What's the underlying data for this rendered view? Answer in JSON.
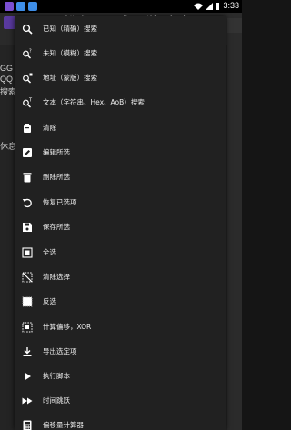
{
  "status_bar": {
    "time": "3:33",
    "app_icon_colors": [
      "#7a4fd0",
      "#3e8ee8",
      "#3e8ee8"
    ]
  },
  "background": {
    "url": "http://gameguardian.net/download",
    "left_text": [
      "GG",
      "QQ",
      "搜索",
      "休息"
    ]
  },
  "menu": {
    "items": [
      {
        "icon": "search-icon",
        "label": "已知（精确）搜索"
      },
      {
        "icon": "search-fuzzy-icon",
        "label": "未知（模糊）搜索"
      },
      {
        "icon": "search-address-icon",
        "label": "地址（蒙版）搜索"
      },
      {
        "icon": "search-text-icon",
        "label": "文本（字符串、Hex、AoB）搜索"
      },
      {
        "icon": "clear-icon",
        "label": "清除"
      },
      {
        "icon": "edit-icon",
        "label": "编辑所选"
      },
      {
        "icon": "delete-icon",
        "label": "删除所选"
      },
      {
        "icon": "restore-icon",
        "label": "恢复已选项"
      },
      {
        "icon": "save-icon",
        "label": "保存所选"
      },
      {
        "icon": "select-all-icon",
        "label": "全选"
      },
      {
        "icon": "clear-selection-icon",
        "label": "清除选择"
      },
      {
        "icon": "invert-icon",
        "label": "反选"
      },
      {
        "icon": "calculate-offset-icon",
        "label": "计算偏移，XOR"
      },
      {
        "icon": "export-icon",
        "label": "导出选定项"
      },
      {
        "icon": "play-icon",
        "label": "执行脚本"
      },
      {
        "icon": "fast-forward-icon",
        "label": "时间跳跃"
      },
      {
        "icon": "calculator-icon",
        "label": "偏移量计算器"
      }
    ]
  }
}
